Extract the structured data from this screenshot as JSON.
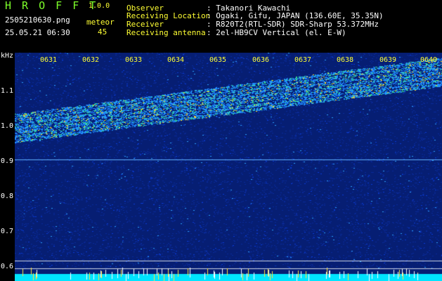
{
  "app": {
    "name": "H R O F F T",
    "version": "1.0.0"
  },
  "file": {
    "name": "2505210630.png",
    "datetime": "25.05.21 06:30"
  },
  "meteor": {
    "label": "meteor",
    "count": "45"
  },
  "station": {
    "observer_label": "Observer",
    "observer_value": ": Takanori Kawachi",
    "location_label": "Receiving Location",
    "location_value": ": Ogaki, Gifu, JAPAN (136.60E, 35.35N)",
    "receiver_label": "Receiver",
    "receiver_value": ": R820T2(RTL-SDR) SDR-Sharp 53.372MHz",
    "antenna_label": "Receiving antenna",
    "antenna_value": ": 2el-HB9CV Vertical (el. E-W)"
  },
  "spectrogram": {
    "unit": "kHz",
    "y_ticks": [
      "1.1",
      "1.0",
      "0.9",
      "0.8",
      "0.7",
      "0.6"
    ],
    "time_ticks": [
      "0631",
      "0632",
      "0633",
      "0634",
      "0635",
      "0636",
      "0637",
      "0638",
      "0639",
      "0640"
    ],
    "colors": {
      "background": "#061e73",
      "noise": "#0a3cd6",
      "signal": "#ffd21e",
      "baseline": "#00e5ff"
    }
  }
}
